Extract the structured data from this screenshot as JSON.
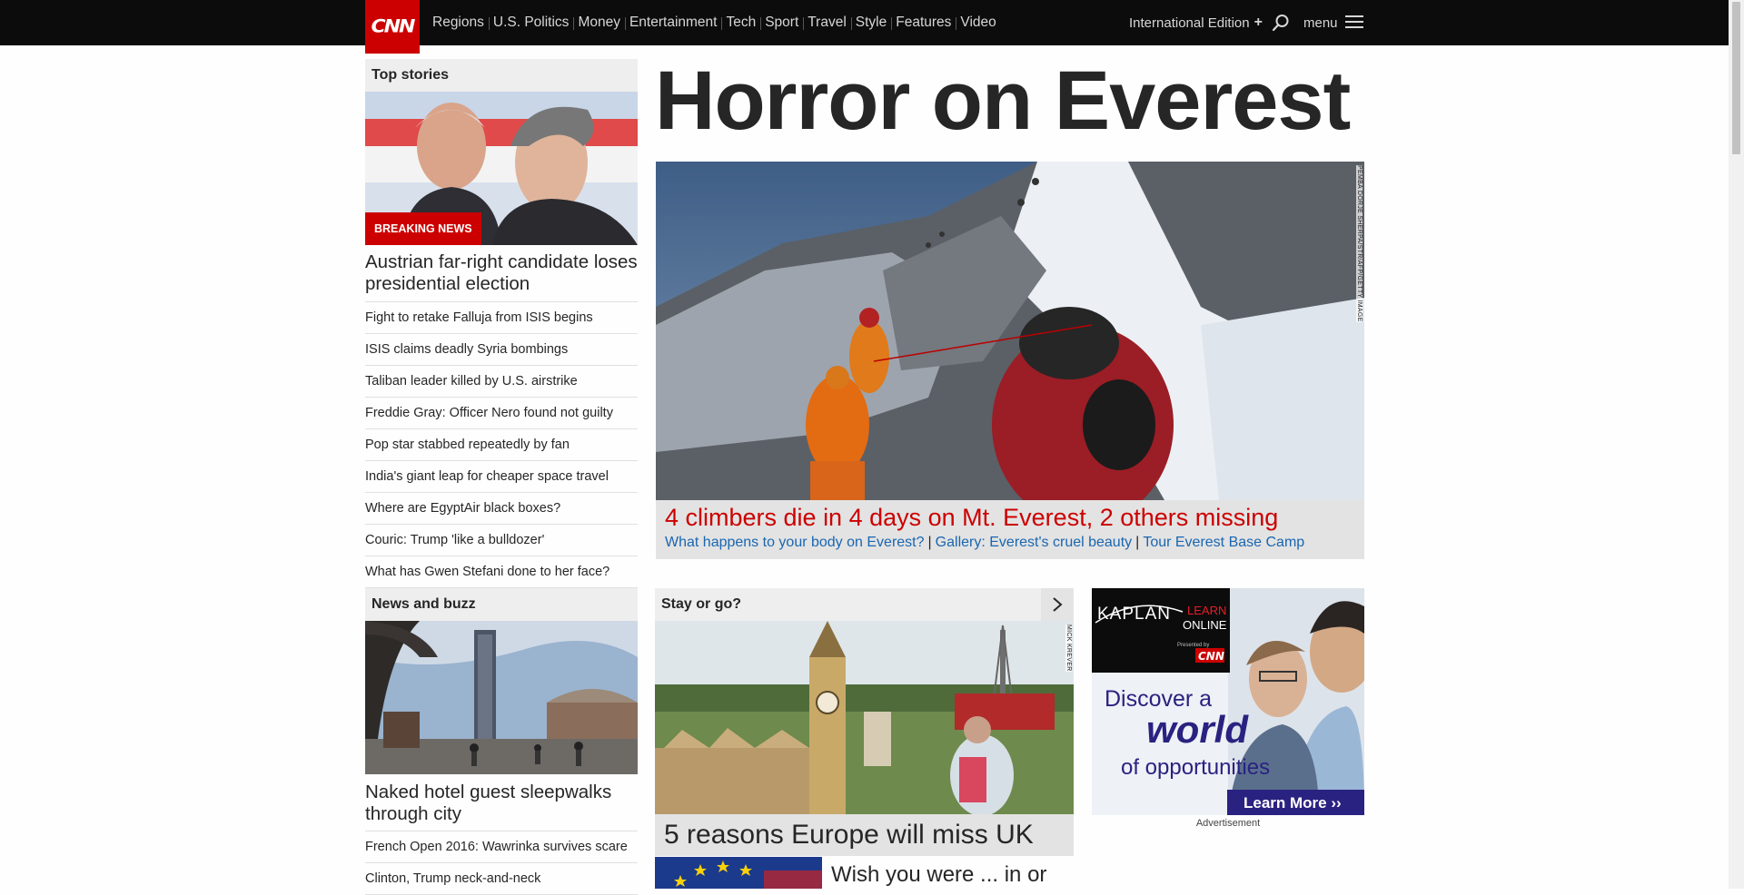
{
  "header": {
    "logo_text": "CNN",
    "nav": [
      "Regions",
      "U.S. Politics",
      "Money",
      "Entertainment",
      "Tech",
      "Sport",
      "Travel",
      "Style",
      "Features",
      "Video"
    ],
    "edition_label": "International Edition",
    "edition_plus": "+",
    "menu_label": "menu",
    "icons": [
      "search-icon",
      "hamburger-icon"
    ]
  },
  "top_stories": {
    "heading": "Top stories",
    "badge": "BREAKING NEWS",
    "lead_headline": "Austrian far-right candidate loses presidential election",
    "items": [
      "Fight to retake Falluja from ISIS begins",
      "ISIS claims deadly Syria bombings",
      "Taliban leader killed by U.S. airstrike",
      "Freddie Gray: Officer Nero found not guilty",
      "Pop star stabbed repeatedly by fan",
      "India's giant leap for cheaper space travel",
      "Where are EgyptAir black boxes?",
      "Couric: Trump 'like a bulldozer'",
      "What has Gwen Stefani done to her face?"
    ]
  },
  "hero": {
    "title": "Horror on Everest",
    "headline": "4 climbers die in 4 days on Mt. Everest, 2 others missing",
    "links": [
      "What happens to your body on Everest?",
      "Gallery: Everest's cruel beauty",
      "Tour Everest Base Camp"
    ],
    "link_separator": "|",
    "photo_credit": "PEMBA DORJE SHERPA/STR/AFP/GETTY IMAGE"
  },
  "news_buzz": {
    "heading": "News and buzz",
    "lead_headline": "Naked hotel guest sleepwalks through city",
    "items": [
      "French Open 2016: Wawrinka survives scare",
      "Clinton, Trump neck-and-neck"
    ]
  },
  "stay_or_go": {
    "heading": "Stay or go?",
    "photo_credit": "MICK KREVER",
    "headline": "5 reasons Europe will miss UK",
    "secondary": "Wish you were ... in or"
  },
  "ad": {
    "brand": "KAPLAN",
    "learn": "LEARN",
    "online": "ONLINE",
    "presented_by": "Presented by",
    "presented_brand": "CNN",
    "line1": "Discover a",
    "line2": "world",
    "line3": "of opportunities",
    "cta": "Learn More ››",
    "label": "Advertisement"
  },
  "colors": {
    "brand_red": "#cc0000",
    "link_blue": "#1a66b0",
    "nav_bg": "#0c0c0c",
    "ad_navy": "#2a2280"
  }
}
